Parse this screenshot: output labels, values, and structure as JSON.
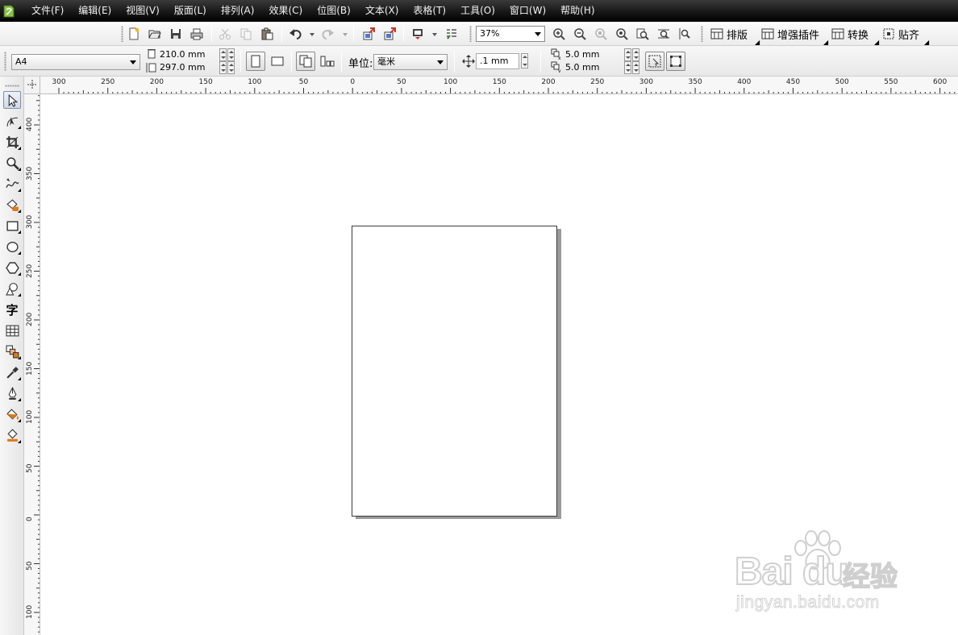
{
  "menubar": {
    "items": [
      "文件(F)",
      "编辑(E)",
      "视图(V)",
      "版面(L)",
      "排列(A)",
      "效果(C)",
      "位图(B)",
      "文本(X)",
      "表格(T)",
      "工具(O)",
      "窗口(W)",
      "帮助(H)"
    ]
  },
  "standard_toolbar": {
    "zoom_level": "37%",
    "plugins": [
      "排版",
      "增强插件",
      "转换",
      "贴齐"
    ]
  },
  "property_bar": {
    "paper_size": "A4",
    "page_width": "210.0 mm",
    "page_height": "297.0 mm",
    "units_label": "单位:",
    "units_value": "毫米",
    "nudge_distance": ".1 mm",
    "duplicate_x": "5.0 mm",
    "duplicate_y": "5.0 mm"
  },
  "rulers": {
    "horizontal_labels": [
      "300",
      "250",
      "200",
      "150",
      "100",
      "50",
      "0",
      "50",
      "100",
      "150",
      "200",
      "250",
      "300",
      "350",
      "400",
      "450",
      "500",
      "550",
      "600"
    ],
    "vertical_labels": [
      "400",
      "350",
      "300",
      "250",
      "200",
      "150",
      "100",
      "50",
      "0",
      "50",
      "100"
    ]
  },
  "toolbox": {
    "tools": [
      "pick-tool",
      "shape-tool",
      "crop-tool",
      "zoom-tool",
      "freehand-tool",
      "smart-fill-tool",
      "rectangle-tool",
      "ellipse-tool",
      "polygon-tool",
      "basic-shapes-tool",
      "text-tool",
      "table-tool",
      "interactive-blend-tool",
      "eyedropper-tool",
      "outline-tool",
      "fill-tool",
      "interactive-fill-tool"
    ],
    "text_tool_glyph": "字"
  },
  "watermark": {
    "brand": "Bai du",
    "cn": "经验",
    "url": "jingyan.baidu.com"
  },
  "colors": {
    "menubar_bg": "#141414",
    "accent_orange": "#e07a14",
    "page_border": "#3c3c3c",
    "page_shadow": "#9a9a9a"
  }
}
